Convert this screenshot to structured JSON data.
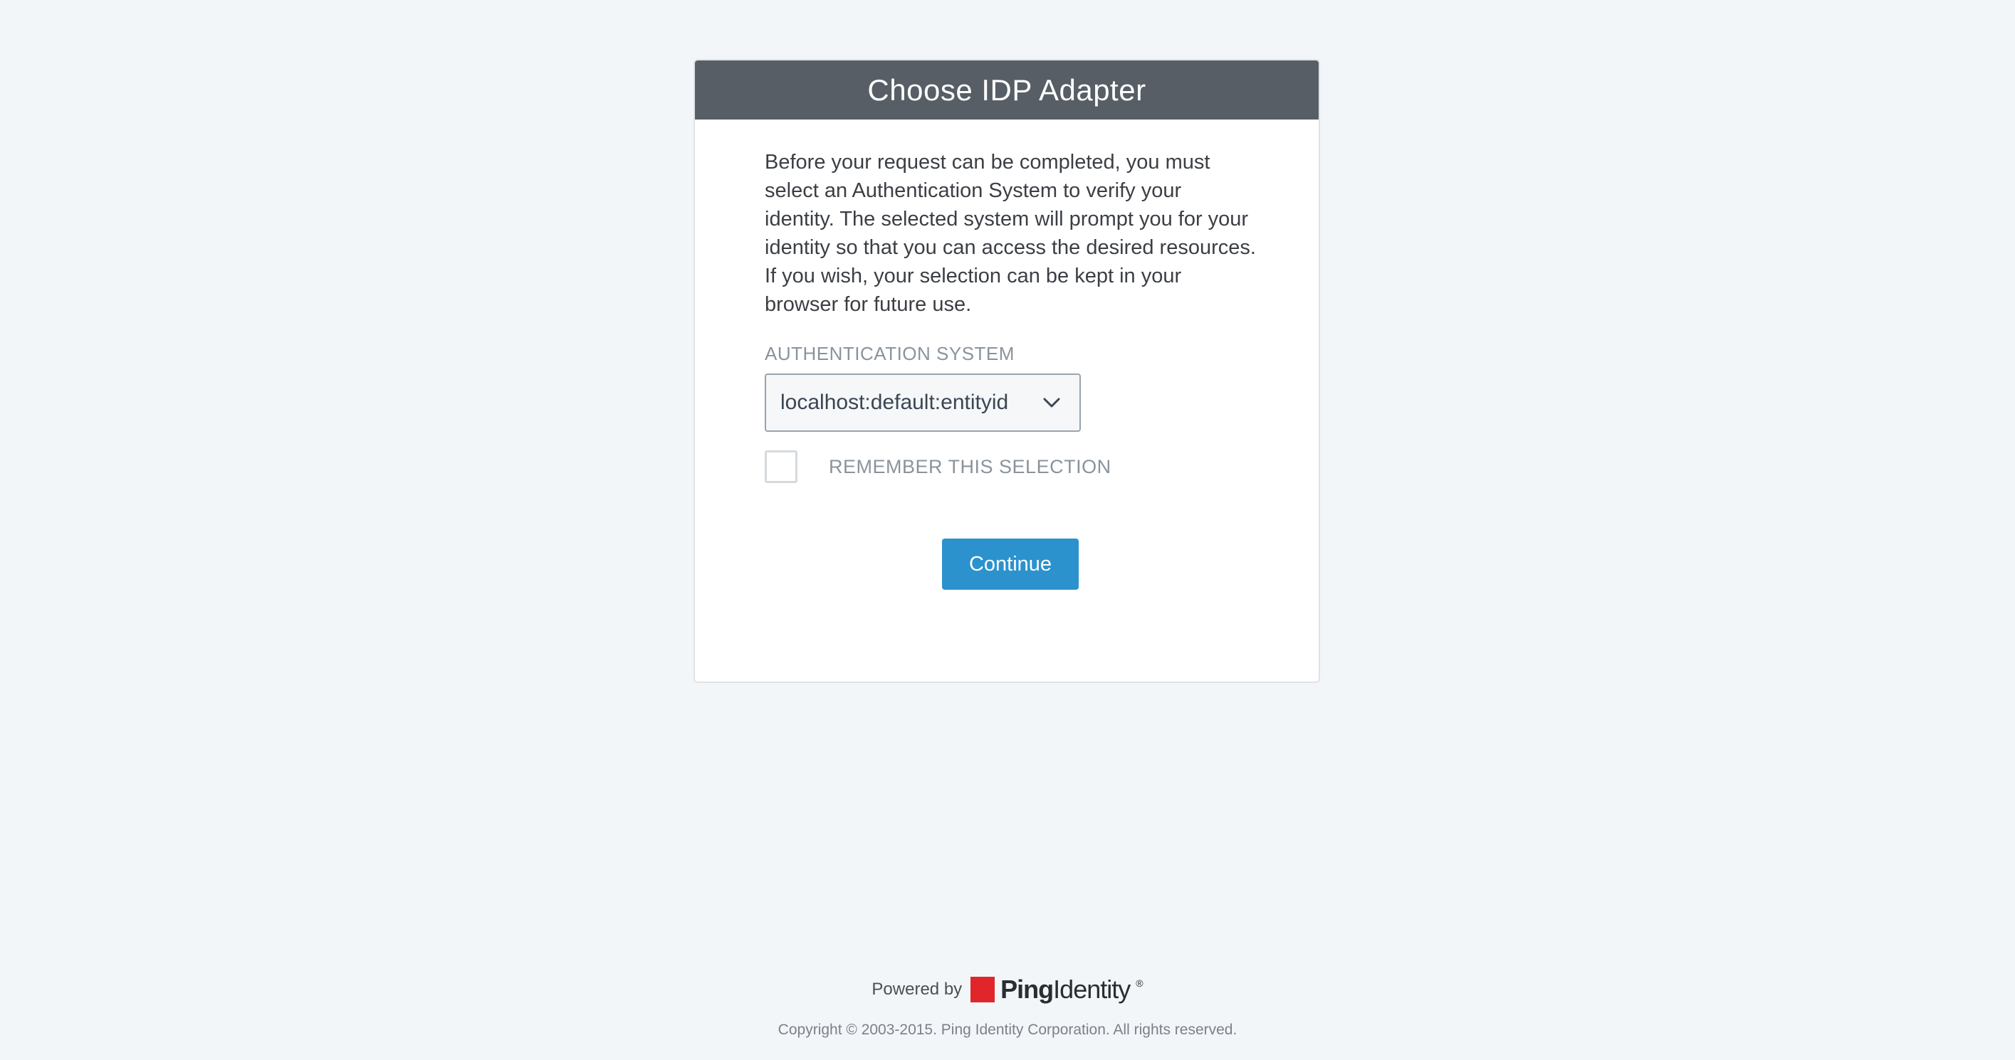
{
  "dialog": {
    "title": "Choose IDP Adapter",
    "intro": "Before your request can be completed, you must select an Authentication System to verify your identity. The selected system will prompt you for your identity so that you can access the desired resources. If you wish, your selection can be kept in your browser for future use.",
    "field_label": "AUTHENTICATION SYSTEM",
    "select_value": "localhost:default:entityid",
    "remember_label": "REMEMBER THIS SELECTION",
    "remember_checked": false,
    "continue_label": "Continue"
  },
  "footer": {
    "powered_by": "Powered by",
    "brand_ping": "Ping",
    "brand_identity": "Identity",
    "brand_mark": "®",
    "copyright": "Copyright © 2003-2015. Ping Identity Corporation. All rights reserved."
  },
  "colors": {
    "header_bg": "#575e66",
    "accent": "#2b92cd",
    "brand_red": "#e0262b",
    "page_bg": "#f3f6f9"
  },
  "icons": {
    "select_chevron": "chevron-down-icon",
    "brand_logo": "ping-identity-logo"
  }
}
